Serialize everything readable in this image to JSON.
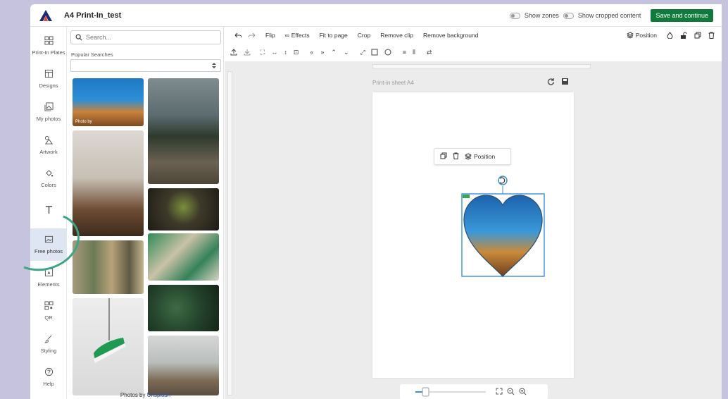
{
  "app": {
    "title": "A4 Print-In_test"
  },
  "topbar": {
    "show_zones": "Show zones",
    "show_cropped": "Show cropped content",
    "save_label": "Save and continue"
  },
  "rail": {
    "items": [
      {
        "label": "Print-In Plates",
        "icon": "grid-icon"
      },
      {
        "label": "Designs",
        "icon": "layout-icon"
      },
      {
        "label": "My photos",
        "icon": "photos-icon"
      },
      {
        "label": "Artwork",
        "icon": "shapes-icon"
      },
      {
        "label": "Colors",
        "icon": "paint-bucket-icon"
      },
      {
        "label": "",
        "icon": "text-icon"
      },
      {
        "label": "Free photos",
        "icon": "image-icon"
      },
      {
        "label": "Elements",
        "icon": "element-icon"
      },
      {
        "label": "QR",
        "icon": "qr-icon"
      },
      {
        "label": "Styling",
        "icon": "brush-icon"
      },
      {
        "label": "Help",
        "icon": "help-icon"
      }
    ]
  },
  "panel": {
    "search_placeholder": "Search...",
    "popular_label": "Popular Searches",
    "photo_overlay": "Photo by",
    "credit_prefix": "Photos by",
    "credit_link": "Unsplash"
  },
  "toolbar": {
    "flip": "Flip",
    "effects": "Effects",
    "fit": "Fit to page",
    "crop": "Crop",
    "remove_clip": "Remove clip",
    "remove_background": "Remove background",
    "position": "Position"
  },
  "canvas": {
    "sheet_label": "Print-in sheet A4",
    "float_position": "Position"
  },
  "colors": {
    "accent": "#0f7a3a",
    "brand": "#1f2a6b",
    "selection": "#3b8fe0"
  }
}
